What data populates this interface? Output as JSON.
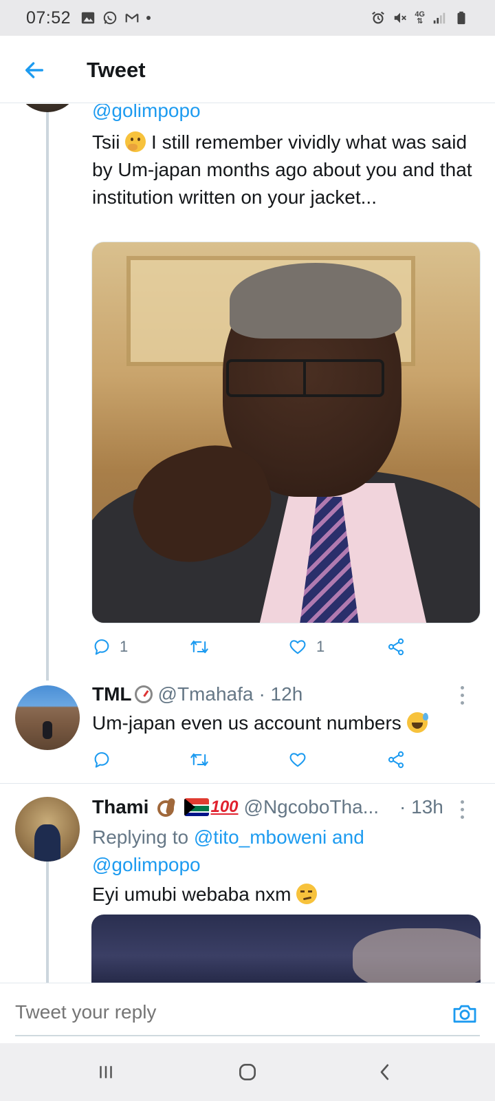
{
  "status_bar": {
    "time": "07:52",
    "left_icons": [
      "image-icon",
      "whatsapp-icon",
      "gmail-icon",
      "notification-dot"
    ],
    "right_icons": [
      "alarm-icon",
      "mute-icon",
      "4g-signal",
      "signal-bars-icon",
      "battery-icon"
    ],
    "network": "4G"
  },
  "header": {
    "title": "Tweet",
    "back_icon": "back-arrow-icon"
  },
  "tweets": [
    {
      "mention_line": "@golimpopo",
      "text_before_emoji": "Tsii ",
      "text_after_emoji": " I still remember vividly what was said by Um-japan months ago about you and that institution written on your jacket...",
      "has_image": true,
      "actions": {
        "replies": "1",
        "retweets": "",
        "likes": "1"
      }
    },
    {
      "name": "TML",
      "handle": "@Tmahafa",
      "time": "· 12h",
      "text": "Um-japan even us account numbers ",
      "actions": {
        "replies": "",
        "retweets": "",
        "likes": ""
      }
    },
    {
      "name": "Thami",
      "handle": "@NgcoboTha...",
      "time": "· 13h",
      "replying_label": "Replying to ",
      "replying_to_1": "@tito_mboweni and",
      "replying_to_2": "@golimpopo",
      "text": "Eyi umubi webaba nxm ",
      "hundred": "100"
    }
  ],
  "reply_bar": {
    "placeholder": "Tweet your reply",
    "camera_icon": "camera-icon"
  },
  "nav_bar": {
    "buttons": [
      "recent-apps-icon",
      "home-icon",
      "back-icon"
    ]
  },
  "colors": {
    "accent": "#1d9bf0",
    "text": "#14171a",
    "muted": "#657786",
    "divider": "#e1e8ed"
  }
}
